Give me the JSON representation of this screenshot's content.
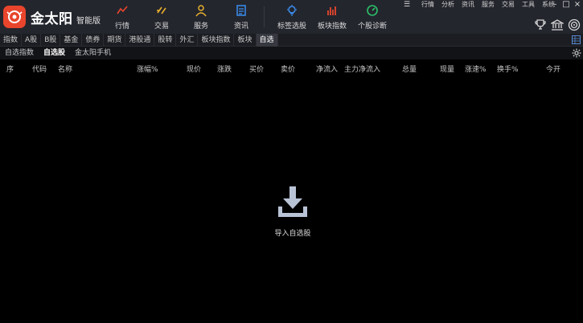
{
  "app": {
    "brand": "金太阳",
    "edition": "智能版"
  },
  "nav": [
    {
      "label": "行情",
      "icon": "chart-line-icon",
      "color": "#e8452c"
    },
    {
      "label": "交易",
      "icon": "trade-icon",
      "color": "#e8b02c"
    },
    {
      "label": "服务",
      "icon": "user-icon",
      "color": "#e8b02c"
    },
    {
      "label": "资讯",
      "icon": "news-icon",
      "color": "#3a8ef0"
    },
    {
      "label": "标签选股",
      "icon": "bulb-icon",
      "color": "#3a8ef0"
    },
    {
      "label": "板块指数",
      "icon": "bar-chart-icon",
      "color": "#e8452c"
    },
    {
      "label": "个股诊断",
      "icon": "gauge-icon",
      "color": "#2cc06a"
    }
  ],
  "top_menu": [
    "行情",
    "分析",
    "资讯",
    "服务",
    "交易",
    "工具",
    "系统"
  ],
  "window_controls": [
    "–",
    "□",
    "×"
  ],
  "tabs": [
    {
      "label": "指数",
      "active": false
    },
    {
      "label": "A股",
      "active": false
    },
    {
      "label": "B股",
      "active": false
    },
    {
      "label": "基金",
      "active": false
    },
    {
      "label": "债券",
      "active": false
    },
    {
      "label": "期货",
      "active": false
    },
    {
      "label": "港股通",
      "active": false
    },
    {
      "label": "股转",
      "active": false
    },
    {
      "label": "外汇",
      "active": false
    },
    {
      "label": "板块指数",
      "active": false
    },
    {
      "label": "板块",
      "active": false
    },
    {
      "label": "自选",
      "active": true
    }
  ],
  "subtabs": [
    {
      "label": "自选指数",
      "active": false
    },
    {
      "label": "自选股",
      "active": true
    },
    {
      "label": "金太阳手机",
      "active": false
    }
  ],
  "columns": [
    "序",
    "代码",
    "名称",
    "涨幅%",
    "现价",
    "涨跌",
    "买价",
    "卖价",
    "净流入",
    "主力净流入",
    "总量",
    "现量",
    "涨速%",
    "换手%",
    "今开"
  ],
  "empty_state": {
    "label": "导入自选股",
    "icon": "download-icon"
  },
  "colors": {
    "accent": "#e8452c",
    "topbar": "#24262e",
    "empty_icon": "#b9c3d6"
  }
}
